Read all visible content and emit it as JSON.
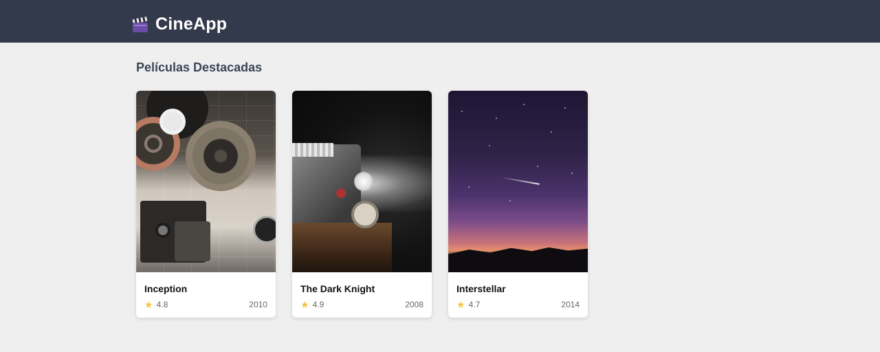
{
  "app": {
    "name": "CineApp",
    "logo_icon": "clapperboard-icon"
  },
  "section": {
    "title": "Películas Destacadas"
  },
  "movies": [
    {
      "title": "Inception",
      "rating": "4.8",
      "year": "2010",
      "poster": "film-reels"
    },
    {
      "title": "The Dark Knight",
      "rating": "4.9",
      "year": "2008",
      "poster": "projector-beam"
    },
    {
      "title": "Interstellar",
      "rating": "4.7",
      "year": "2014",
      "poster": "starry-night-sky"
    }
  ],
  "colors": {
    "header_bg": "#323a4b",
    "page_bg": "#efefef",
    "star": "#f2c53d",
    "section_title": "#3a4556"
  }
}
